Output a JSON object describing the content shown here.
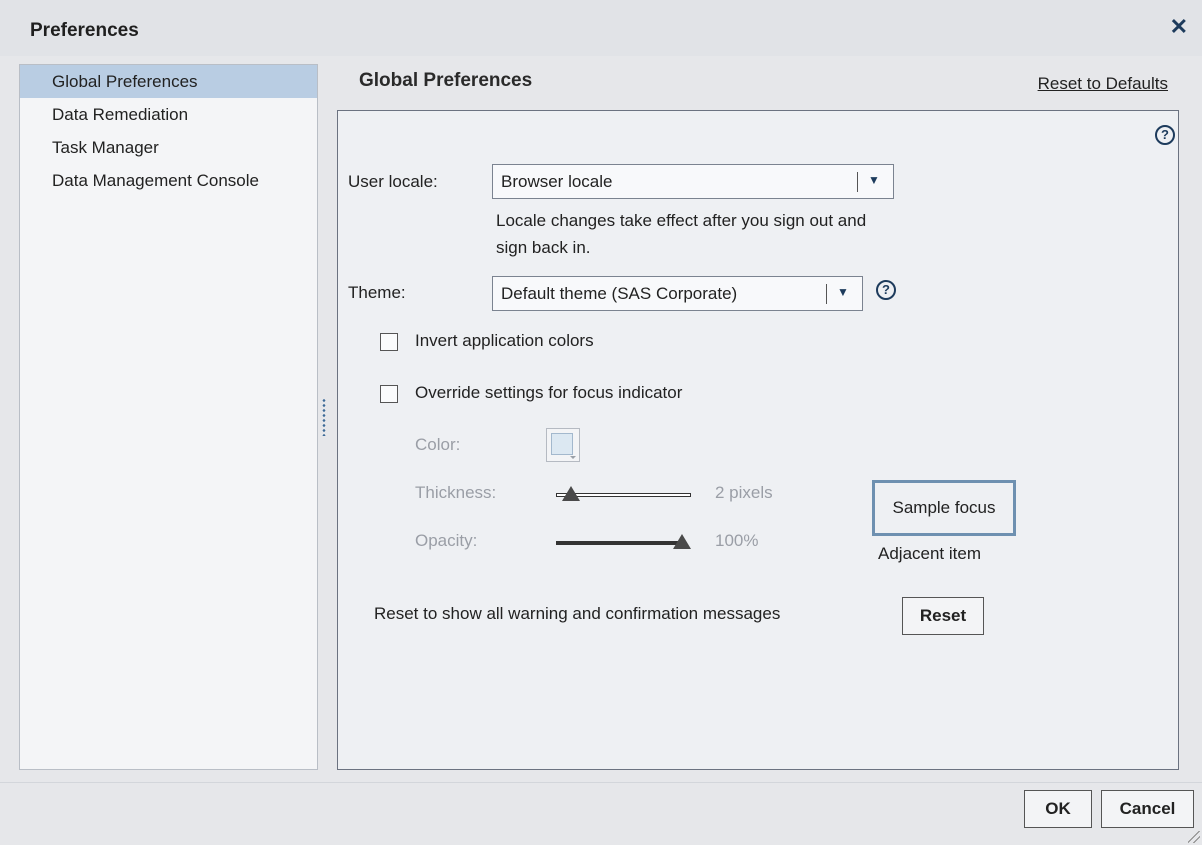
{
  "dialog": {
    "title": "Preferences",
    "close_icon": "close-icon"
  },
  "nav": {
    "items": [
      {
        "label": "Global Preferences",
        "selected": true
      },
      {
        "label": "Data Remediation"
      },
      {
        "label": "Task Manager"
      },
      {
        "label": "Data Management Console"
      }
    ]
  },
  "panel": {
    "title": "Global Preferences",
    "reset_defaults": "Reset to Defaults",
    "user_locale": {
      "label": "User locale:",
      "value": "Browser locale",
      "note": "Locale changes take effect after you sign out and sign back in."
    },
    "theme": {
      "label": "Theme:",
      "value": "Default theme (SAS Corporate)"
    },
    "invert": {
      "label": "Invert application colors",
      "checked": false
    },
    "override": {
      "label": "Override settings for focus indicator",
      "checked": false
    },
    "color": {
      "label": "Color:"
    },
    "thickness": {
      "label": "Thickness:",
      "value_text": "2 pixels",
      "level": 0.05
    },
    "opacity": {
      "label": "Opacity:",
      "value_text": "100%",
      "level": 1.0
    },
    "sample_focus": "Sample focus",
    "adjacent_item": "Adjacent item",
    "reset_messages": {
      "label": "Reset to show all warning and confirmation messages",
      "button": "Reset"
    }
  },
  "footer": {
    "ok": "OK",
    "cancel": "Cancel"
  },
  "colors": {
    "nav_selected": "#b9cde3",
    "accent": "#1d3b5c",
    "focus_border": "#6e90b0"
  }
}
